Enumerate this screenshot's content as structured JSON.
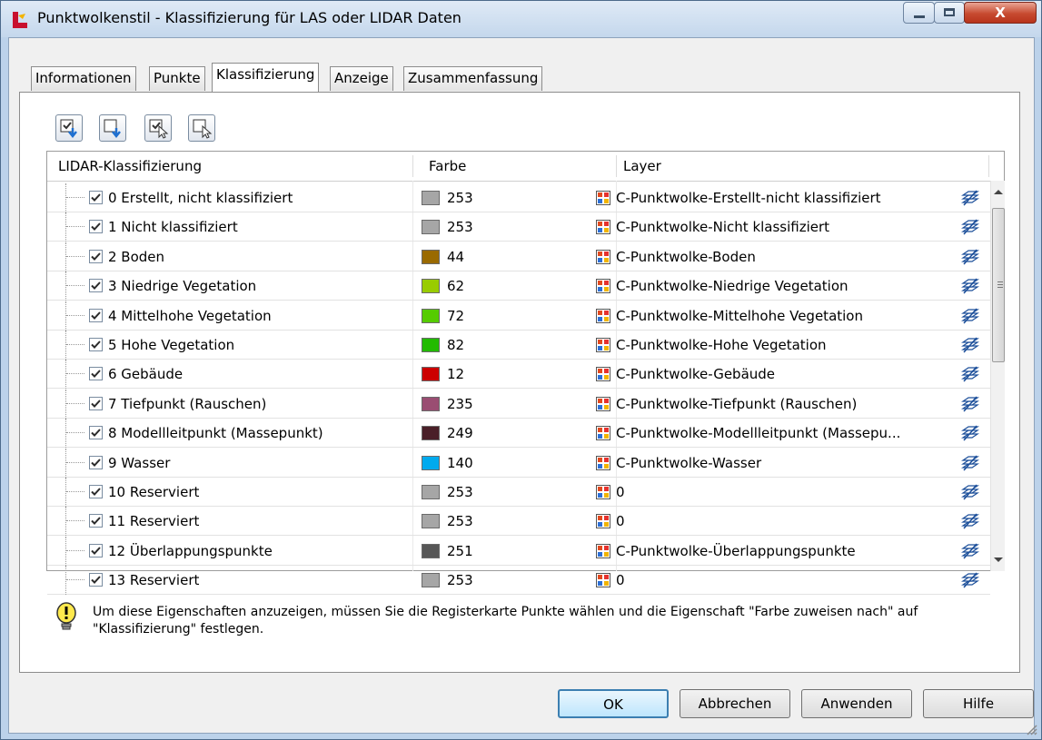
{
  "window": {
    "title": "Punktwolkenstil - Klassifizierung für LAS oder LIDAR Daten",
    "close_label": "X"
  },
  "tabs": [
    {
      "label": "Informationen"
    },
    {
      "label": "Punkte"
    },
    {
      "label": "Klassifizierung",
      "active": true
    },
    {
      "label": "Anzeige"
    },
    {
      "label": "Zusammenfassung"
    }
  ],
  "grid": {
    "headers": {
      "classification": "LIDAR-Klassifizierung",
      "color": "Farbe",
      "layer": "Layer"
    },
    "rows": [
      {
        "name": "0 Erstellt, nicht klassifiziert",
        "checked": true,
        "swatch": "#a6a6a6",
        "color": "253",
        "layer": "C-Punktwolke-Erstellt-nicht klassifiziert"
      },
      {
        "name": "1 Nicht klassifiziert",
        "checked": true,
        "swatch": "#a6a6a6",
        "color": "253",
        "layer": "C-Punktwolke-Nicht klassifiziert"
      },
      {
        "name": "2 Boden",
        "checked": true,
        "swatch": "#9a6a00",
        "color": "44",
        "layer": "C-Punktwolke-Boden"
      },
      {
        "name": "3 Niedrige Vegetation",
        "checked": true,
        "swatch": "#99cc00",
        "color": "62",
        "layer": "C-Punktwolke-Niedrige Vegetation"
      },
      {
        "name": "4 Mittelhohe Vegetation",
        "checked": true,
        "swatch": "#55cc00",
        "color": "72",
        "layer": "C-Punktwolke-Mittelhohe Vegetation"
      },
      {
        "name": "5 Hohe Vegetation",
        "checked": true,
        "swatch": "#22bb00",
        "color": "82",
        "layer": "C-Punktwolke-Hohe Vegetation"
      },
      {
        "name": "6 Gebäude",
        "checked": true,
        "swatch": "#cc0000",
        "color": "12",
        "layer": "C-Punktwolke-Gebäude"
      },
      {
        "name": "7 Tiefpunkt (Rauschen)",
        "checked": true,
        "swatch": "#9a4d72",
        "color": "235",
        "layer": "C-Punktwolke-Tiefpunkt (Rauschen)"
      },
      {
        "name": "8 Modellleitpunkt (Massepunkt)",
        "checked": true,
        "swatch": "#4a1f28",
        "color": "249",
        "layer": "C-Punktwolke-Modellleitpunkt (Massepu..."
      },
      {
        "name": "9 Wasser",
        "checked": true,
        "swatch": "#00aaee",
        "color": "140",
        "layer": "C-Punktwolke-Wasser"
      },
      {
        "name": "10 Reserviert",
        "checked": true,
        "swatch": "#a6a6a6",
        "color": "253",
        "layer": "0"
      },
      {
        "name": "11 Reserviert",
        "checked": true,
        "swatch": "#a6a6a6",
        "color": "253",
        "layer": "0"
      },
      {
        "name": "12 Überlappungspunkte",
        "checked": true,
        "swatch": "#575757",
        "color": "251",
        "layer": "C-Punktwolke-Überlappungspunkte"
      },
      {
        "name": "13 Reserviert",
        "checked": true,
        "swatch": "#a6a6a6",
        "color": "253",
        "layer": "0"
      }
    ]
  },
  "toolbar": [
    {
      "icon": "check-all-down-icon"
    },
    {
      "icon": "uncheck-all-down-icon"
    },
    {
      "icon": "check-selected-icon"
    },
    {
      "icon": "uncheck-selected-icon"
    }
  ],
  "info": {
    "text": "Um diese Eigenschaften anzuzeigen, müssen Sie die Registerkarte Punkte wählen und die Eigenschaft \"Farbe zuweisen nach\" auf \"Klassifizierung\" festlegen."
  },
  "buttons": {
    "ok": "OK",
    "cancel": "Abbrechen",
    "apply": "Anwenden",
    "help": "Hilfe"
  }
}
